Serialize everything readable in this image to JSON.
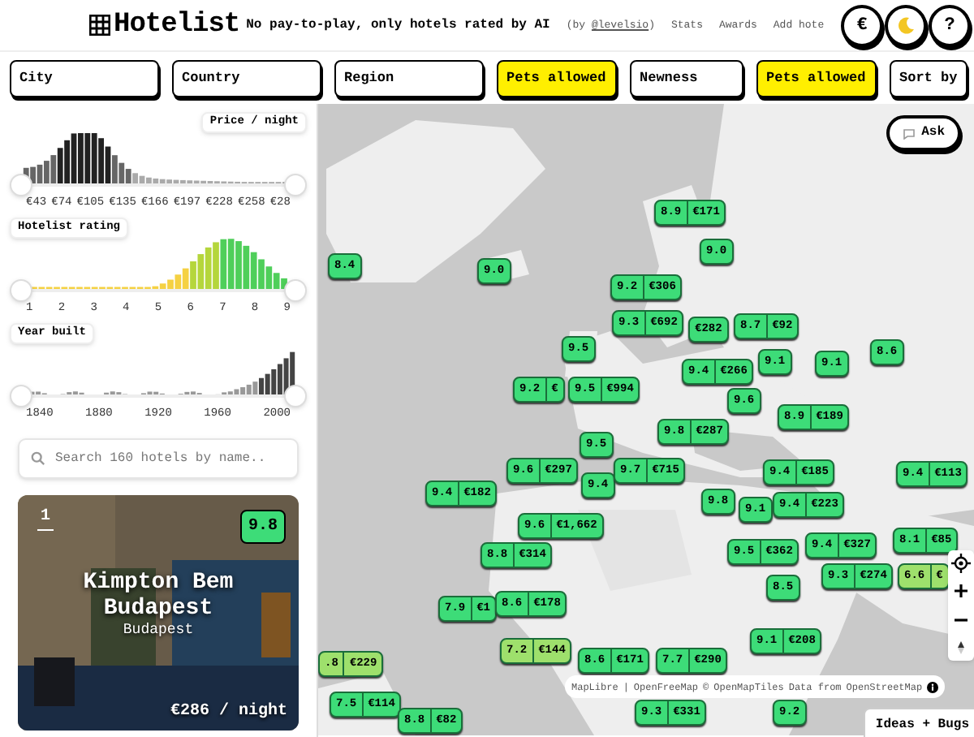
{
  "header": {
    "logo": "Hotelist",
    "tagline": "No pay-to-play, only hotels rated by AI",
    "byline": "(by ",
    "author": "@levelsio",
    "byline_end": ")",
    "links": [
      "Stats",
      "Awards",
      "Add hote"
    ],
    "round_buttons": [
      {
        "kind": "text",
        "label": "€"
      },
      {
        "kind": "moon"
      },
      {
        "kind": "text",
        "label": "?"
      }
    ]
  },
  "filters": [
    {
      "label": "City",
      "selected": false
    },
    {
      "label": "Country",
      "selected": false
    },
    {
      "label": "Region",
      "selected": false
    },
    {
      "label": "Pets allowed",
      "selected": true
    },
    {
      "label": "Newness",
      "selected": false
    },
    {
      "label": "Pets allowed",
      "selected": true
    },
    {
      "label": "Sort by",
      "selected": false
    }
  ],
  "sidebar": {
    "price": {
      "label": "Price / night",
      "thumbs": [
        {
          "level": 0
        },
        {
          "level": 1
        }
      ],
      "ticks": [
        "€43",
        "€74",
        "€105",
        "€135",
        "€166",
        "€197",
        "€228",
        "€258",
        "€28"
      ]
    },
    "rating": {
      "label": "Hotelist rating",
      "thumbs": [
        {
          "level": 0
        },
        {
          "level": 1
        }
      ],
      "ticks": [
        "1",
        "2",
        "3",
        "4",
        "5",
        "6",
        "7",
        "8",
        "9"
      ]
    },
    "year": {
      "label": "Year built",
      "thumbs": [
        {
          "level": 0
        },
        {
          "level": 1
        }
      ],
      "ticks": [
        "1840",
        "1880",
        "1920",
        "1960",
        "2000"
      ]
    },
    "search": {
      "placeholder": "Search 160 hotels by name.."
    },
    "card": {
      "rank": "1",
      "rating": "9.8",
      "name": "Kimpton Bem Budapest",
      "city": "Budapest",
      "price": "€286 / night"
    }
  },
  "map": {
    "ask": "Ask",
    "attribution": [
      "MapLibre",
      "|",
      "OpenFreeMap",
      "©",
      "OpenMapTiles",
      "Data from",
      "OpenStreetMap"
    ],
    "feedback": "Ideas + Bugs",
    "markers": [
      {
        "rating": "8.9",
        "price": "€171",
        "color": "#3ddc78"
      },
      {
        "rating": "9.0",
        "color": "#3ddc78"
      },
      {
        "rating": "8.4",
        "color": "#3ddc78"
      },
      {
        "rating": "9.0",
        "color": "#3ddc78"
      },
      {
        "rating": "9.2",
        "price": "€306",
        "color": "#3ddc78"
      },
      {
        "price": "€282",
        "color": "#3ddc78"
      },
      {
        "rating": "9.3",
        "price": "€692",
        "color": "#3ddc78"
      },
      {
        "rating": "8.7",
        "price": "€92",
        "color": "#3ddc78"
      },
      {
        "rating": "9.5",
        "color": "#3ddc78"
      },
      {
        "rating": "9.2",
        "price": "€",
        "color": "#3ddc78"
      },
      {
        "rating": "9.5",
        "price": "€994",
        "color": "#3ddc78"
      },
      {
        "rating": "9.4",
        "price": "€266",
        "color": "#3ddc78"
      },
      {
        "rating": "9.1",
        "color": "#3ddc78"
      },
      {
        "rating": "9.1",
        "color": "#3ddc78"
      },
      {
        "rating": "8.6",
        "color": "#3ddc78"
      },
      {
        "rating": "9.6",
        "color": "#3ddc78"
      },
      {
        "rating": "8.9",
        "price": "€189",
        "color": "#3ddc78"
      },
      {
        "rating": "9.8",
        "price": "€287",
        "color": "#3ddc78"
      },
      {
        "rating": "9.5",
        "color": "#3ddc78"
      },
      {
        "rating": "9.6",
        "price": "€297",
        "color": "#3ddc78"
      },
      {
        "rating": "9.4",
        "color": "#3ddc78"
      },
      {
        "rating": "9.7",
        "price": "€715",
        "color": "#3ddc78"
      },
      {
        "rating": "9.4",
        "price": "€185",
        "color": "#3ddc78"
      },
      {
        "rating": "9.4",
        "price": "€113",
        "color": "#3ddc78"
      },
      {
        "rating": "9.4",
        "price": "€182",
        "color": "#3ddc78"
      },
      {
        "rating": "9.8",
        "color": "#3ddc78"
      },
      {
        "rating": "9.1",
        "color": "#3ddc78"
      },
      {
        "rating": "9.4",
        "price": "€223",
        "color": "#3ddc78"
      },
      {
        "rating": "9.6",
        "price": "€1,662",
        "color": "#3ddc78"
      },
      {
        "rating": "8.8",
        "price": "€314",
        "color": "#3ddc78"
      },
      {
        "rating": "9.5",
        "price": "€362",
        "color": "#3ddc78"
      },
      {
        "rating": "9.4",
        "price": "€327",
        "color": "#3ddc78"
      },
      {
        "rating": "8.1",
        "price": "€85",
        "color": "#3ddc78"
      },
      {
        "rating": "9.3",
        "price": "€274",
        "color": "#3ddc78"
      },
      {
        "rating": "6.6",
        "price": "€",
        "color": "#9ee06c"
      },
      {
        "rating": "8.5",
        "color": "#3ddc78"
      },
      {
        "rating": "7.9",
        "price": "€1",
        "color": "#3ddc78"
      },
      {
        "rating": "8.6",
        "price": "€178",
        "color": "#3ddc78"
      },
      {
        "rating": "7.2",
        "price": "€144",
        "color": "#9ee06c"
      },
      {
        "rating": "9.1",
        "price": "€208",
        "color": "#3ddc78"
      },
      {
        "rating": ".8",
        "price": "€229",
        "color": "#9ee06c"
      },
      {
        "rating": "8.6",
        "price": "€171",
        "color": "#3ddc78"
      },
      {
        "rating": "7.7",
        "price": "€290",
        "color": "#3ddc78"
      },
      {
        "rating": "7.5",
        "price": "€114",
        "color": "#3ddc78"
      },
      {
        "rating": "9.3",
        "price": "€331",
        "color": "#3ddc78"
      },
      {
        "rating": "9.2",
        "color": "#3ddc78"
      },
      {
        "rating": "8.8",
        "price": "€82",
        "color": "#3ddc78"
      }
    ]
  }
}
